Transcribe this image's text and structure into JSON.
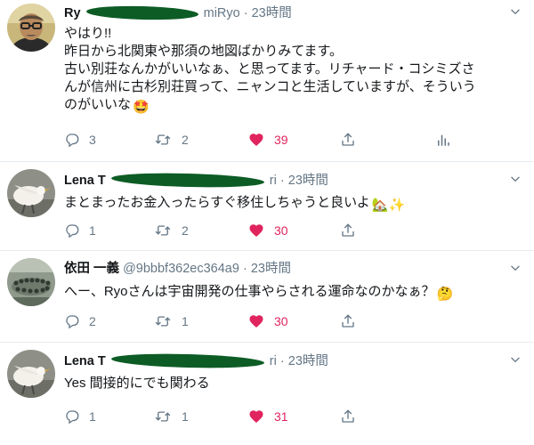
{
  "tweets": [
    {
      "name": "Ry",
      "handle_suffix": "miRyo",
      "separator": "·",
      "time": "23時間",
      "text_lines": [
        "やはり!!",
        "昨日から北関東や那須の地図ばかりみてます。",
        "古い別荘なんかがいいなぁ、と思ってます。リチャード・コシミズさ",
        "んが信州に古杉別荘買って、ニャンコと生活していますが、そういう",
        "のがいいな"
      ],
      "emoji": "🤩",
      "replies": "3",
      "retweets": "2",
      "likes": "39",
      "avatar_icon": "profile-photo-man-glasses",
      "colors": {
        "like": "#e0245e",
        "muted": "#657786",
        "redaction": "#0d5c25"
      }
    },
    {
      "name": "Lena T",
      "handle_suffix": "ri",
      "separator": "·",
      "time": "23時間",
      "text_lines": [
        "まとまったお金入ったらすぐ移住しちゃうと良いよ"
      ],
      "emoji": "🏡✨",
      "replies": "1",
      "retweets": "2",
      "likes": "30",
      "avatar_icon": "profile-photo-white-bird"
    },
    {
      "name": "依田 一義",
      "handle": "@9bbbf362ec364a9",
      "separator": "·",
      "time": "23時間",
      "text_lines": [
        "へー、Ryoさんは宇宙開発の仕事やらされる運命なのかなぁ？"
      ],
      "emoji": "🤔",
      "replies": "2",
      "retweets": "1",
      "likes": "30",
      "avatar_icon": "profile-photo-crowd"
    },
    {
      "name": "Lena T",
      "handle_suffix": "ri",
      "separator": "·",
      "time": "23時間",
      "text_lines": [
        "Yes 間接的にでも関わる"
      ],
      "emoji": "",
      "replies": "1",
      "retweets": "1",
      "likes": "31",
      "avatar_icon": "profile-photo-white-bird"
    }
  ]
}
